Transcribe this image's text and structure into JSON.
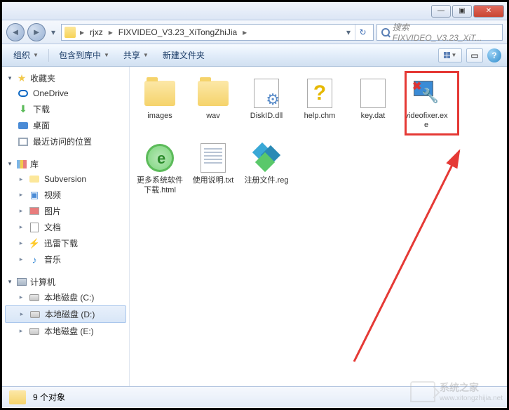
{
  "window": {
    "min": "—",
    "max": "▣",
    "close": "✕"
  },
  "breadcrumb": {
    "items": [
      "rjxz",
      "FIXVIDEO_V3.23_XiTongZhiJia"
    ],
    "refresh_glyph": "↻",
    "dropdown_glyph": "▾"
  },
  "search": {
    "placeholder": "搜索 FIXVIDEO_V3.23_XiT..."
  },
  "toolbar": {
    "organize": "组织",
    "include": "包含到库中",
    "share": "共享",
    "newfolder": "新建文件夹",
    "dd": "▼"
  },
  "sidebar": {
    "favorites": {
      "label": "收藏夹",
      "arrow": "▸",
      "arrow_open": "▾"
    },
    "fav_items": [
      {
        "label": "OneDrive"
      },
      {
        "label": "下载"
      },
      {
        "label": "桌面"
      },
      {
        "label": "最近访问的位置"
      }
    ],
    "libraries": {
      "label": "库"
    },
    "lib_items": [
      {
        "label": "Subversion"
      },
      {
        "label": "视频"
      },
      {
        "label": "图片"
      },
      {
        "label": "文档"
      },
      {
        "label": "迅雷下载"
      },
      {
        "label": "音乐"
      }
    ],
    "computer": {
      "label": "计算机"
    },
    "comp_items": [
      {
        "label": "本地磁盘 (C:)"
      },
      {
        "label": "本地磁盘 (D:)",
        "selected": true
      },
      {
        "label": "本地磁盘 (E:)"
      }
    ]
  },
  "files": [
    {
      "name": "images",
      "type": "folder"
    },
    {
      "name": "wav",
      "type": "folder"
    },
    {
      "name": "DiskID.dll",
      "type": "dll"
    },
    {
      "name": "help.chm",
      "type": "chm"
    },
    {
      "name": "key.dat",
      "type": "dat"
    },
    {
      "name": "videofixer.exe",
      "type": "exe",
      "highlighted": true
    },
    {
      "name": "更多系统软件下载.html",
      "type": "html"
    },
    {
      "name": "使用说明.txt",
      "type": "txt"
    },
    {
      "name": "注册文件.reg",
      "type": "reg"
    }
  ],
  "status": {
    "count_label": "9 个对象"
  },
  "watermark": {
    "text": "系统之家",
    "url": "www.xitongzhijia.net"
  }
}
